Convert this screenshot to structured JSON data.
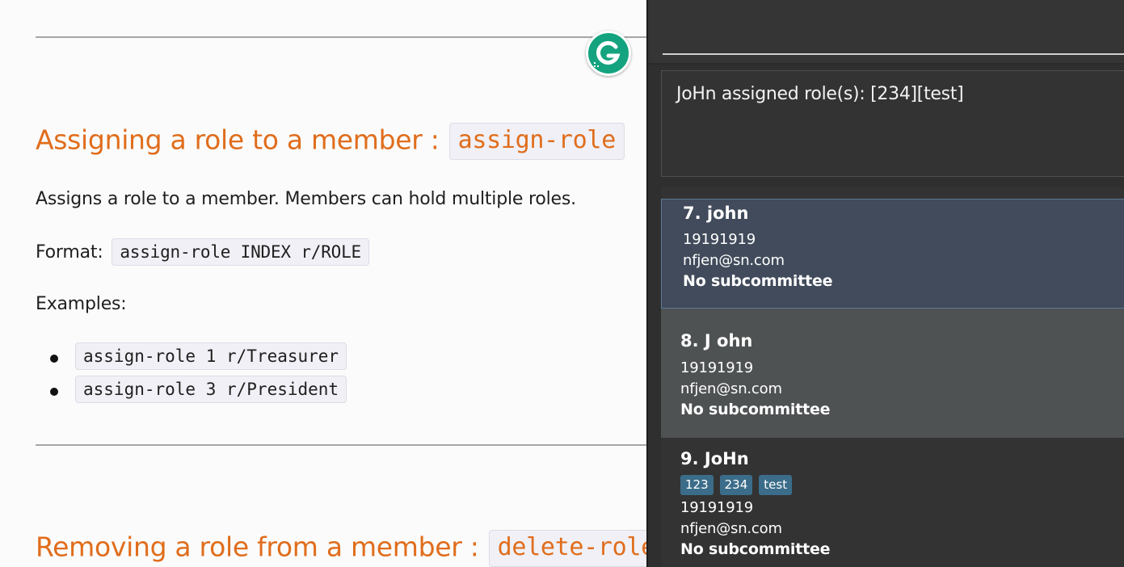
{
  "doc": {
    "section1": {
      "heading": "Assigning a role to a member :",
      "heading_code": "assign-role",
      "description": "Assigns a role to a member. Members can hold multiple roles.",
      "format_label": "Format:",
      "format_code": "assign-role INDEX r/ROLE",
      "examples_label": "Examples:",
      "examples": [
        "assign-role 1 r/Treasurer",
        "assign-role 3 r/President"
      ]
    },
    "section2": {
      "heading": "Removing a role from a member :",
      "heading_code": "delete-role"
    }
  },
  "app": {
    "result_message": "JoHn assigned role(s): [234][test]",
    "members": [
      {
        "name": "7. john",
        "phone": "19191919",
        "email": "nfjen@sn.com",
        "subcommittee": "No subcommittee",
        "tags": []
      },
      {
        "name": "8. J ohn",
        "phone": "19191919",
        "email": "nfjen@sn.com",
        "subcommittee": "No subcommittee",
        "tags": []
      },
      {
        "name": "9. JoHn",
        "phone": "19191919",
        "email": "nfjen@sn.com",
        "subcommittee": "No subcommittee",
        "tags": [
          "123",
          "234",
          "test"
        ]
      }
    ]
  },
  "colors": {
    "heading": "#e06d1c",
    "app_bg": "#2f2f2f",
    "selected_card": "#414b5b",
    "hover_card": "#4f5253",
    "tag_bg": "#3b6d8a",
    "grammarly": "#14a37f"
  },
  "icons": {
    "grammarly_badge": "grammarly-icon"
  }
}
